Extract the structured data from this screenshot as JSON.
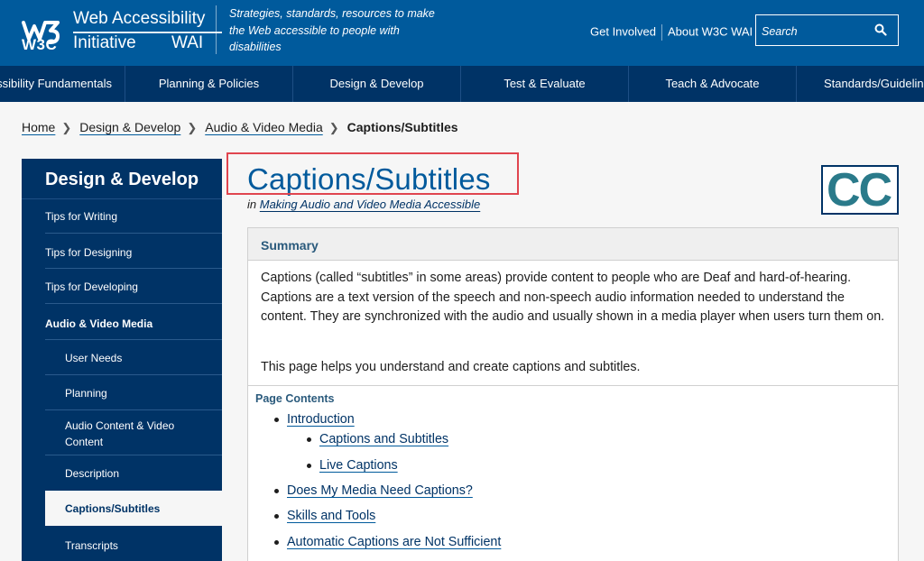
{
  "header": {
    "logo_w3c": "W3C",
    "logo_line1": "Web Accessibility",
    "logo_line2": "Initiative",
    "logo_wai": "WAI",
    "tagline": "Strategies, standards, resources to make the Web accessible to people with disabilities",
    "links": [
      "Get Involved",
      "About W3C WAI"
    ],
    "search_placeholder": "Search",
    "brand_color": "#005a9c"
  },
  "mainnav": {
    "items": [
      "Accessibility Fundamentals",
      "Planning & Policies",
      "Design & Develop",
      "Test & Evaluate",
      "Teach & Advocate",
      "Standards/Guidelines"
    ],
    "color": "#003366"
  },
  "breadcrumb": {
    "items": [
      "Home",
      "Design & Develop",
      "Audio & Video Media"
    ],
    "current": "Captions/Subtitles"
  },
  "sidebar": {
    "title": "Design & Develop",
    "items": [
      "Tips for Writing",
      "Tips for Designing",
      "Tips for Developing",
      "Audio & Video Media"
    ],
    "subitems": [
      "User Needs",
      "Planning",
      "Audio Content & Video Content",
      "Description",
      "Captions/Subtitles",
      "Transcripts"
    ],
    "active": "Captions/Subtitles"
  },
  "content": {
    "title": "Captions/Subtitles",
    "in_prefix": "in",
    "parent_link": "Making Audio and Video Media Accessible",
    "cc_icon_text": "CC",
    "summary_heading": "Summary",
    "summary_p1": "Captions (called “subtitles” in some areas) provide content to people who are Deaf and hard-of-hearing. Captions are a text version of the speech and non-speech audio information needed to understand the content. They are synchronized with the audio and usually shown in a media player when users turn them on.",
    "summary_p2": "This page helps you understand and create captions and subtitles.",
    "contents_heading": "Page Contents",
    "toc": [
      "Introduction",
      "Captions and Subtitles",
      "Live Captions",
      "Does My Media Need Captions?",
      "Skills and Tools",
      "Automatic Captions are Not Sufficient"
    ],
    "highlight_color": "#e0454f"
  }
}
